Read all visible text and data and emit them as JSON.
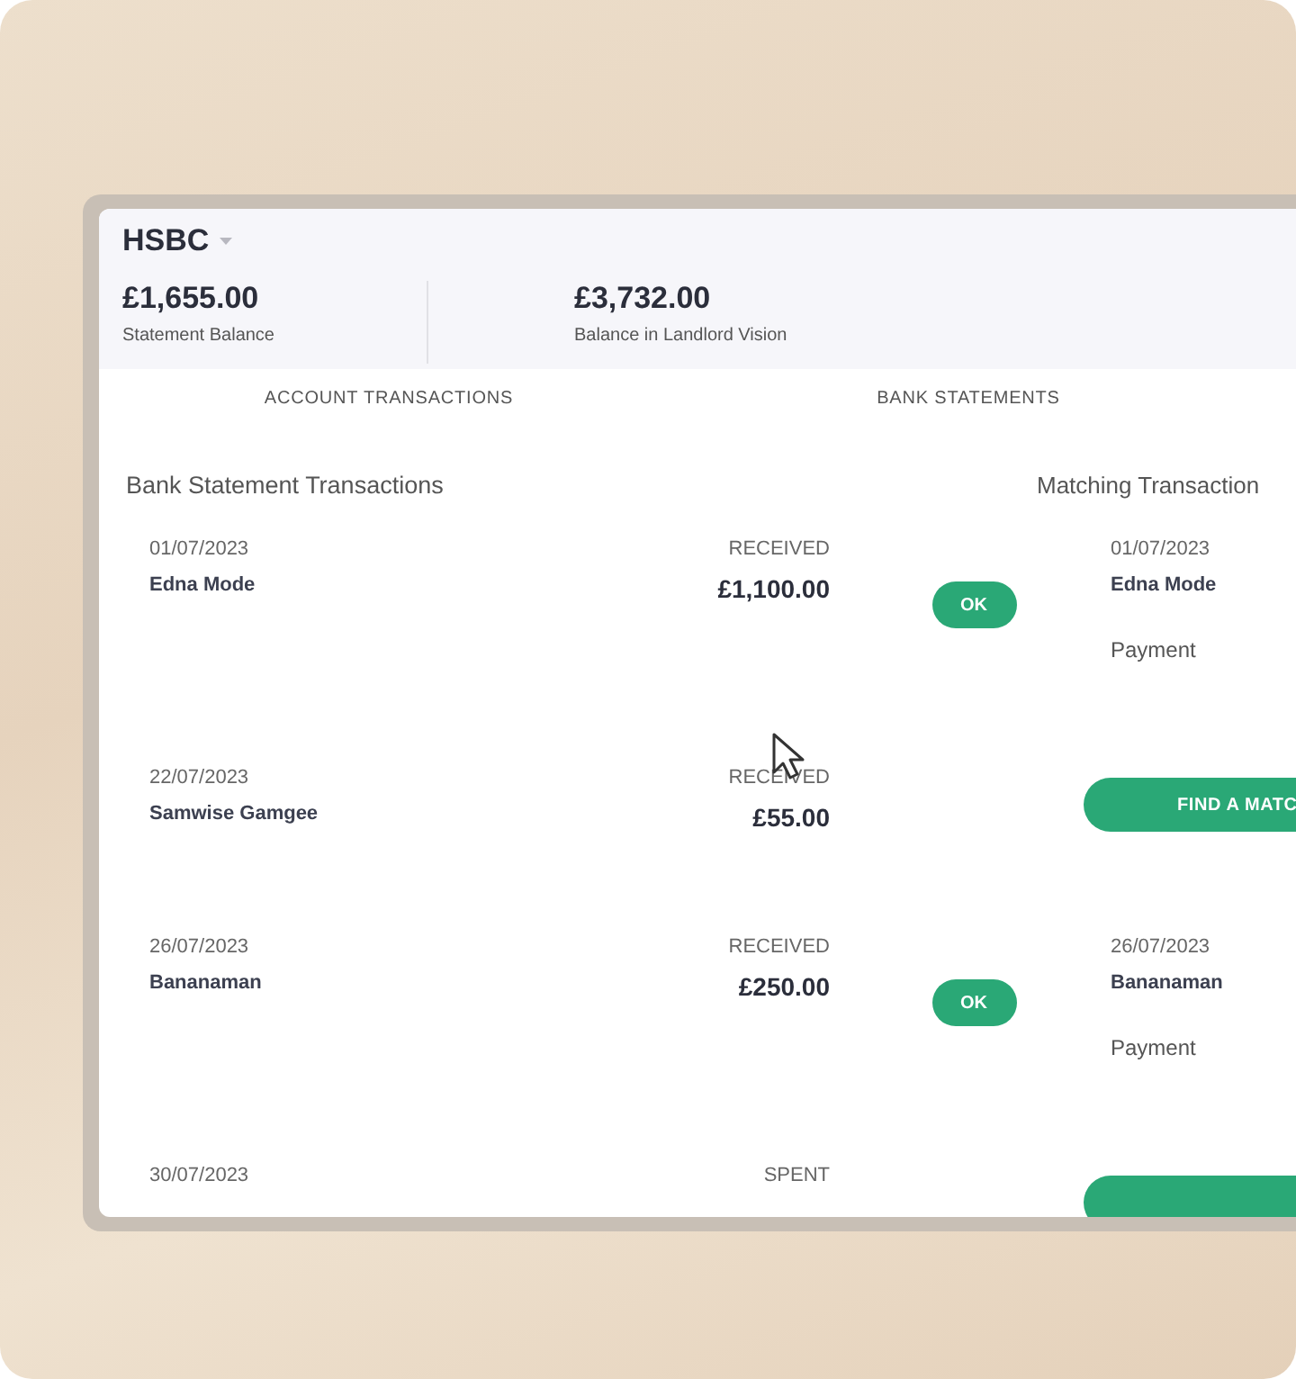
{
  "account": {
    "name": "HSBC"
  },
  "balances": [
    {
      "amount": "£1,655.00",
      "label": "Statement Balance"
    },
    {
      "amount": "£3,732.00",
      "label": "Balance in Landlord Vision"
    }
  ],
  "tabs": [
    {
      "label": "ACCOUNT TRANSACTIONS",
      "selected": false
    },
    {
      "label": "BANK STATEMENTS",
      "selected": false
    }
  ],
  "left_title": "Bank Statement Transactions",
  "right_title": "Matching Transaction",
  "rows": [
    {
      "kind": "matched",
      "date": "01/07/2023",
      "name": "Edna Mode",
      "type": "RECEIVED",
      "amount": "£1,100.00",
      "button": "OK",
      "match": {
        "date": "01/07/2023",
        "name": "Edna Mode",
        "category": "Payment"
      }
    },
    {
      "kind": "unmatched",
      "date": "22/07/2023",
      "name": "Samwise Gamgee",
      "type": "RECEIVED",
      "amount": "£55.00",
      "button": "FIND A MATC"
    },
    {
      "kind": "matched",
      "date": "26/07/2023",
      "name": "Bananaman",
      "type": "RECEIVED",
      "amount": "£250.00",
      "button": "OK",
      "match": {
        "date": "26/07/2023",
        "name": "Bananaman",
        "category": "Payment"
      }
    },
    {
      "kind": "unmatched",
      "date": "30/07/2023",
      "type": "SPENT"
    }
  ]
}
